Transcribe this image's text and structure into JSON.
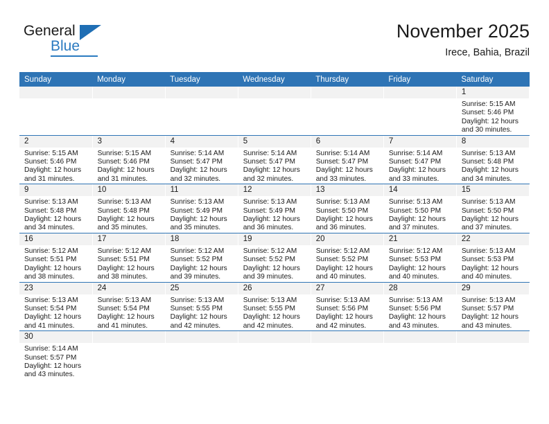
{
  "brand": {
    "name_top": "General",
    "name_bottom": "Blue",
    "accent_color": "#2a7ac0",
    "triangle_color": "#1f6eb4"
  },
  "header": {
    "title": "November 2025",
    "location": "Irece, Bahia, Brazil",
    "header_bg": "#2e74b5",
    "daynum_bg": "#f2f2f2"
  },
  "weekday_headers": [
    "Sunday",
    "Monday",
    "Tuesday",
    "Wednesday",
    "Thursday",
    "Friday",
    "Saturday"
  ],
  "labels": {
    "sunrise_prefix": "Sunrise:",
    "sunset_prefix": "Sunset:",
    "daylight_prefix": "Daylight:"
  },
  "weeks": [
    [
      {
        "day": "",
        "empty": true,
        "sunrise": "",
        "sunset": "",
        "daylight_line1": "",
        "daylight_line2": ""
      },
      {
        "day": "",
        "empty": true,
        "sunrise": "",
        "sunset": "",
        "daylight_line1": "",
        "daylight_line2": ""
      },
      {
        "day": "",
        "empty": true,
        "sunrise": "",
        "sunset": "",
        "daylight_line1": "",
        "daylight_line2": ""
      },
      {
        "day": "",
        "empty": true,
        "sunrise": "",
        "sunset": "",
        "daylight_line1": "",
        "daylight_line2": ""
      },
      {
        "day": "",
        "empty": true,
        "sunrise": "",
        "sunset": "",
        "daylight_line1": "",
        "daylight_line2": ""
      },
      {
        "day": "",
        "empty": true,
        "sunrise": "",
        "sunset": "",
        "daylight_line1": "",
        "daylight_line2": ""
      },
      {
        "day": "1",
        "empty": false,
        "sunrise": "Sunrise: 5:15 AM",
        "sunset": "Sunset: 5:46 PM",
        "daylight_line1": "Daylight: 12 hours",
        "daylight_line2": "and 30 minutes."
      }
    ],
    [
      {
        "day": "2",
        "empty": false,
        "sunrise": "Sunrise: 5:15 AM",
        "sunset": "Sunset: 5:46 PM",
        "daylight_line1": "Daylight: 12 hours",
        "daylight_line2": "and 31 minutes."
      },
      {
        "day": "3",
        "empty": false,
        "sunrise": "Sunrise: 5:15 AM",
        "sunset": "Sunset: 5:46 PM",
        "daylight_line1": "Daylight: 12 hours",
        "daylight_line2": "and 31 minutes."
      },
      {
        "day": "4",
        "empty": false,
        "sunrise": "Sunrise: 5:14 AM",
        "sunset": "Sunset: 5:47 PM",
        "daylight_line1": "Daylight: 12 hours",
        "daylight_line2": "and 32 minutes."
      },
      {
        "day": "5",
        "empty": false,
        "sunrise": "Sunrise: 5:14 AM",
        "sunset": "Sunset: 5:47 PM",
        "daylight_line1": "Daylight: 12 hours",
        "daylight_line2": "and 32 minutes."
      },
      {
        "day": "6",
        "empty": false,
        "sunrise": "Sunrise: 5:14 AM",
        "sunset": "Sunset: 5:47 PM",
        "daylight_line1": "Daylight: 12 hours",
        "daylight_line2": "and 33 minutes."
      },
      {
        "day": "7",
        "empty": false,
        "sunrise": "Sunrise: 5:14 AM",
        "sunset": "Sunset: 5:47 PM",
        "daylight_line1": "Daylight: 12 hours",
        "daylight_line2": "and 33 minutes."
      },
      {
        "day": "8",
        "empty": false,
        "sunrise": "Sunrise: 5:13 AM",
        "sunset": "Sunset: 5:48 PM",
        "daylight_line1": "Daylight: 12 hours",
        "daylight_line2": "and 34 minutes."
      }
    ],
    [
      {
        "day": "9",
        "empty": false,
        "sunrise": "Sunrise: 5:13 AM",
        "sunset": "Sunset: 5:48 PM",
        "daylight_line1": "Daylight: 12 hours",
        "daylight_line2": "and 34 minutes."
      },
      {
        "day": "10",
        "empty": false,
        "sunrise": "Sunrise: 5:13 AM",
        "sunset": "Sunset: 5:48 PM",
        "daylight_line1": "Daylight: 12 hours",
        "daylight_line2": "and 35 minutes."
      },
      {
        "day": "11",
        "empty": false,
        "sunrise": "Sunrise: 5:13 AM",
        "sunset": "Sunset: 5:49 PM",
        "daylight_line1": "Daylight: 12 hours",
        "daylight_line2": "and 35 minutes."
      },
      {
        "day": "12",
        "empty": false,
        "sunrise": "Sunrise: 5:13 AM",
        "sunset": "Sunset: 5:49 PM",
        "daylight_line1": "Daylight: 12 hours",
        "daylight_line2": "and 36 minutes."
      },
      {
        "day": "13",
        "empty": false,
        "sunrise": "Sunrise: 5:13 AM",
        "sunset": "Sunset: 5:50 PM",
        "daylight_line1": "Daylight: 12 hours",
        "daylight_line2": "and 36 minutes."
      },
      {
        "day": "14",
        "empty": false,
        "sunrise": "Sunrise: 5:13 AM",
        "sunset": "Sunset: 5:50 PM",
        "daylight_line1": "Daylight: 12 hours",
        "daylight_line2": "and 37 minutes."
      },
      {
        "day": "15",
        "empty": false,
        "sunrise": "Sunrise: 5:13 AM",
        "sunset": "Sunset: 5:50 PM",
        "daylight_line1": "Daylight: 12 hours",
        "daylight_line2": "and 37 minutes."
      }
    ],
    [
      {
        "day": "16",
        "empty": false,
        "sunrise": "Sunrise: 5:12 AM",
        "sunset": "Sunset: 5:51 PM",
        "daylight_line1": "Daylight: 12 hours",
        "daylight_line2": "and 38 minutes."
      },
      {
        "day": "17",
        "empty": false,
        "sunrise": "Sunrise: 5:12 AM",
        "sunset": "Sunset: 5:51 PM",
        "daylight_line1": "Daylight: 12 hours",
        "daylight_line2": "and 38 minutes."
      },
      {
        "day": "18",
        "empty": false,
        "sunrise": "Sunrise: 5:12 AM",
        "sunset": "Sunset: 5:52 PM",
        "daylight_line1": "Daylight: 12 hours",
        "daylight_line2": "and 39 minutes."
      },
      {
        "day": "19",
        "empty": false,
        "sunrise": "Sunrise: 5:12 AM",
        "sunset": "Sunset: 5:52 PM",
        "daylight_line1": "Daylight: 12 hours",
        "daylight_line2": "and 39 minutes."
      },
      {
        "day": "20",
        "empty": false,
        "sunrise": "Sunrise: 5:12 AM",
        "sunset": "Sunset: 5:52 PM",
        "daylight_line1": "Daylight: 12 hours",
        "daylight_line2": "and 40 minutes."
      },
      {
        "day": "21",
        "empty": false,
        "sunrise": "Sunrise: 5:12 AM",
        "sunset": "Sunset: 5:53 PM",
        "daylight_line1": "Daylight: 12 hours",
        "daylight_line2": "and 40 minutes."
      },
      {
        "day": "22",
        "empty": false,
        "sunrise": "Sunrise: 5:13 AM",
        "sunset": "Sunset: 5:53 PM",
        "daylight_line1": "Daylight: 12 hours",
        "daylight_line2": "and 40 minutes."
      }
    ],
    [
      {
        "day": "23",
        "empty": false,
        "sunrise": "Sunrise: 5:13 AM",
        "sunset": "Sunset: 5:54 PM",
        "daylight_line1": "Daylight: 12 hours",
        "daylight_line2": "and 41 minutes."
      },
      {
        "day": "24",
        "empty": false,
        "sunrise": "Sunrise: 5:13 AM",
        "sunset": "Sunset: 5:54 PM",
        "daylight_line1": "Daylight: 12 hours",
        "daylight_line2": "and 41 minutes."
      },
      {
        "day": "25",
        "empty": false,
        "sunrise": "Sunrise: 5:13 AM",
        "sunset": "Sunset: 5:55 PM",
        "daylight_line1": "Daylight: 12 hours",
        "daylight_line2": "and 42 minutes."
      },
      {
        "day": "26",
        "empty": false,
        "sunrise": "Sunrise: 5:13 AM",
        "sunset": "Sunset: 5:55 PM",
        "daylight_line1": "Daylight: 12 hours",
        "daylight_line2": "and 42 minutes."
      },
      {
        "day": "27",
        "empty": false,
        "sunrise": "Sunrise: 5:13 AM",
        "sunset": "Sunset: 5:56 PM",
        "daylight_line1": "Daylight: 12 hours",
        "daylight_line2": "and 42 minutes."
      },
      {
        "day": "28",
        "empty": false,
        "sunrise": "Sunrise: 5:13 AM",
        "sunset": "Sunset: 5:56 PM",
        "daylight_line1": "Daylight: 12 hours",
        "daylight_line2": "and 43 minutes."
      },
      {
        "day": "29",
        "empty": false,
        "sunrise": "Sunrise: 5:13 AM",
        "sunset": "Sunset: 5:57 PM",
        "daylight_line1": "Daylight: 12 hours",
        "daylight_line2": "and 43 minutes."
      }
    ],
    [
      {
        "day": "30",
        "empty": false,
        "sunrise": "Sunrise: 5:14 AM",
        "sunset": "Sunset: 5:57 PM",
        "daylight_line1": "Daylight: 12 hours",
        "daylight_line2": "and 43 minutes."
      },
      {
        "day": "",
        "empty": true,
        "sunrise": "",
        "sunset": "",
        "daylight_line1": "",
        "daylight_line2": ""
      },
      {
        "day": "",
        "empty": true,
        "sunrise": "",
        "sunset": "",
        "daylight_line1": "",
        "daylight_line2": ""
      },
      {
        "day": "",
        "empty": true,
        "sunrise": "",
        "sunset": "",
        "daylight_line1": "",
        "daylight_line2": ""
      },
      {
        "day": "",
        "empty": true,
        "sunrise": "",
        "sunset": "",
        "daylight_line1": "",
        "daylight_line2": ""
      },
      {
        "day": "",
        "empty": true,
        "sunrise": "",
        "sunset": "",
        "daylight_line1": "",
        "daylight_line2": ""
      },
      {
        "day": "",
        "empty": true,
        "sunrise": "",
        "sunset": "",
        "daylight_line1": "",
        "daylight_line2": ""
      }
    ]
  ]
}
